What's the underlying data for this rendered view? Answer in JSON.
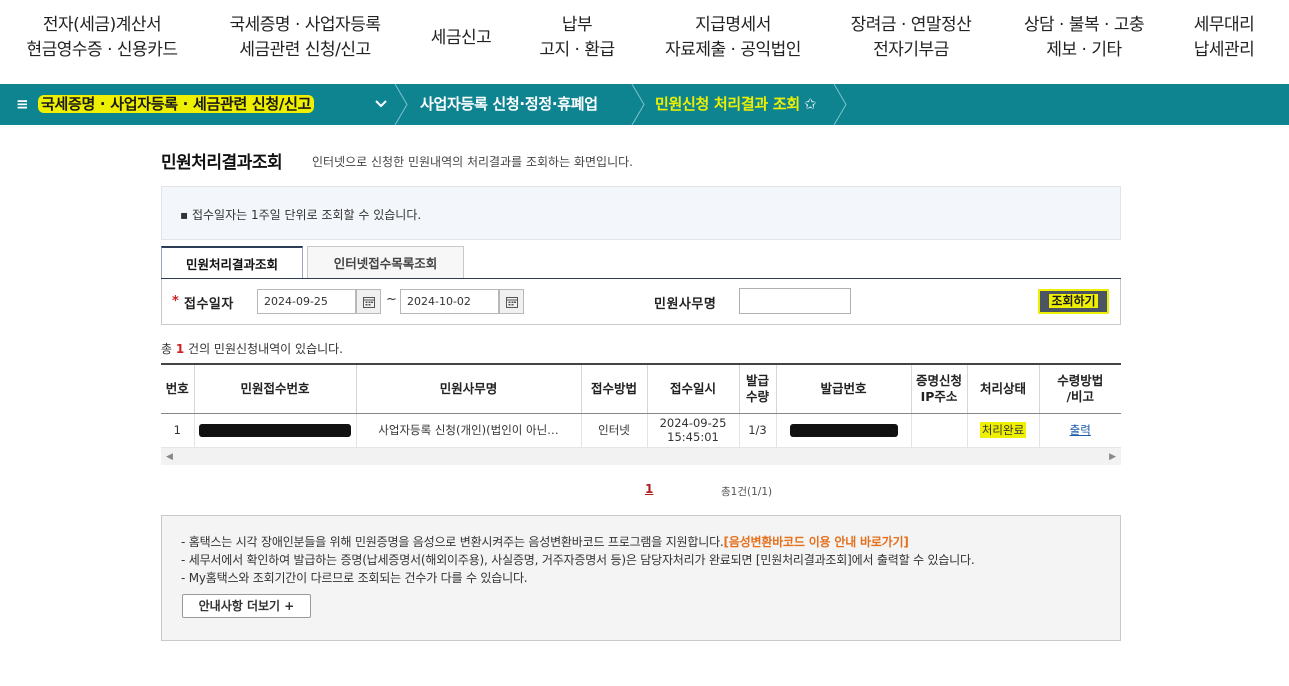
{
  "topnav": [
    {
      "line1": "전자(세금)계산서",
      "line2": "현금영수증 · 신용카드"
    },
    {
      "line1": "국세증명 · 사업자등록",
      "line2": "세금관련 신청/신고"
    },
    {
      "line1": "세금신고",
      "line2": ""
    },
    {
      "line1": "납부",
      "line2": "고지 · 환급"
    },
    {
      "line1": "지급명세서",
      "line2": "자료제출 · 공익법인"
    },
    {
      "line1": "장려금 · 연말정산",
      "line2": "전자기부금"
    },
    {
      "line1": "상담 · 불복 · 고충",
      "line2": "제보 · 기타"
    },
    {
      "line1": "세무대리",
      "line2": "납세관리"
    }
  ],
  "breadcrumb": {
    "menu_icon": "≡",
    "level1": "국세증명 · 사업자등록 · 세금관련 신청/신고",
    "level2": "사업자등록 신청·정정·휴폐업",
    "level3": "민원신청 처리결과 조회",
    "star": "✩"
  },
  "page": {
    "title": "민원처리결과조회",
    "description": "인터넷으로 신청한 민원내역의 처리결과를 조회하는 화면입니다.",
    "notice": "접수일자는 1주일 단위로 조회할 수 있습니다."
  },
  "tabs": [
    {
      "label": "민원처리결과조회",
      "active": true
    },
    {
      "label": "인터넷접수목록조회",
      "active": false
    }
  ],
  "search": {
    "required_mark": "*",
    "date_label": "접수일자",
    "date_from": "2024-09-25",
    "date_to": "2024-10-02",
    "tilde": "~",
    "office_label": "민원사무명",
    "office_value": "",
    "button": "조회하기"
  },
  "result": {
    "prefix": "총 ",
    "count": "1",
    "suffix": " 건의 민원신청내역이 있습니다."
  },
  "table": {
    "headers": [
      {
        "l1": "번호",
        "l2": ""
      },
      {
        "l1": "민원접수번호",
        "l2": ""
      },
      {
        "l1": "민원사무명",
        "l2": ""
      },
      {
        "l1": "접수방법",
        "l2": ""
      },
      {
        "l1": "접수일시",
        "l2": ""
      },
      {
        "l1": "발급",
        "l2": "수량"
      },
      {
        "l1": "발급번호",
        "l2": ""
      },
      {
        "l1": "증명신청",
        "l2": "IP주소"
      },
      {
        "l1": "처리상태",
        "l2": ""
      },
      {
        "l1": "수령방법",
        "l2": "/비고"
      }
    ],
    "rows": [
      {
        "no": "1",
        "office_name": "사업자등록 신청(개인)(법인이 아닌…",
        "method": "인터넷",
        "date": "2024-09-25",
        "time": "15:45:01",
        "qty": "1/3",
        "ip": "",
        "status": "처리완료",
        "receive": "출력"
      }
    ]
  },
  "pager": {
    "current": "1",
    "total": "총1건(1/1)"
  },
  "guide": {
    "line1": "- 홈택스는 시각 장애인분들을 위해 민원증명을 음성으로 변환시켜주는 음성변환바코드 프로그램을 지원합니다.",
    "line1_link": "[음성변환바코드 이용 안내 바로가기]",
    "line2": "- 세무서에서 확인하여 발급하는 증명(납세증명서(해외이주용), 사실증명, 거주자증명서 등)은 담당자처리가 완료되면 [민원처리결과조회]에서 출력할 수 있습니다.",
    "line3": "- My홈택스와 조회기간이 다르므로 조회되는 건수가 다를 수 있습니다.",
    "more_button": "안내사항 더보기 +"
  },
  "colors": {
    "bar": "#0e8491",
    "highlight": "#eef000",
    "button": "#4a5463",
    "link": "#e5701c"
  }
}
